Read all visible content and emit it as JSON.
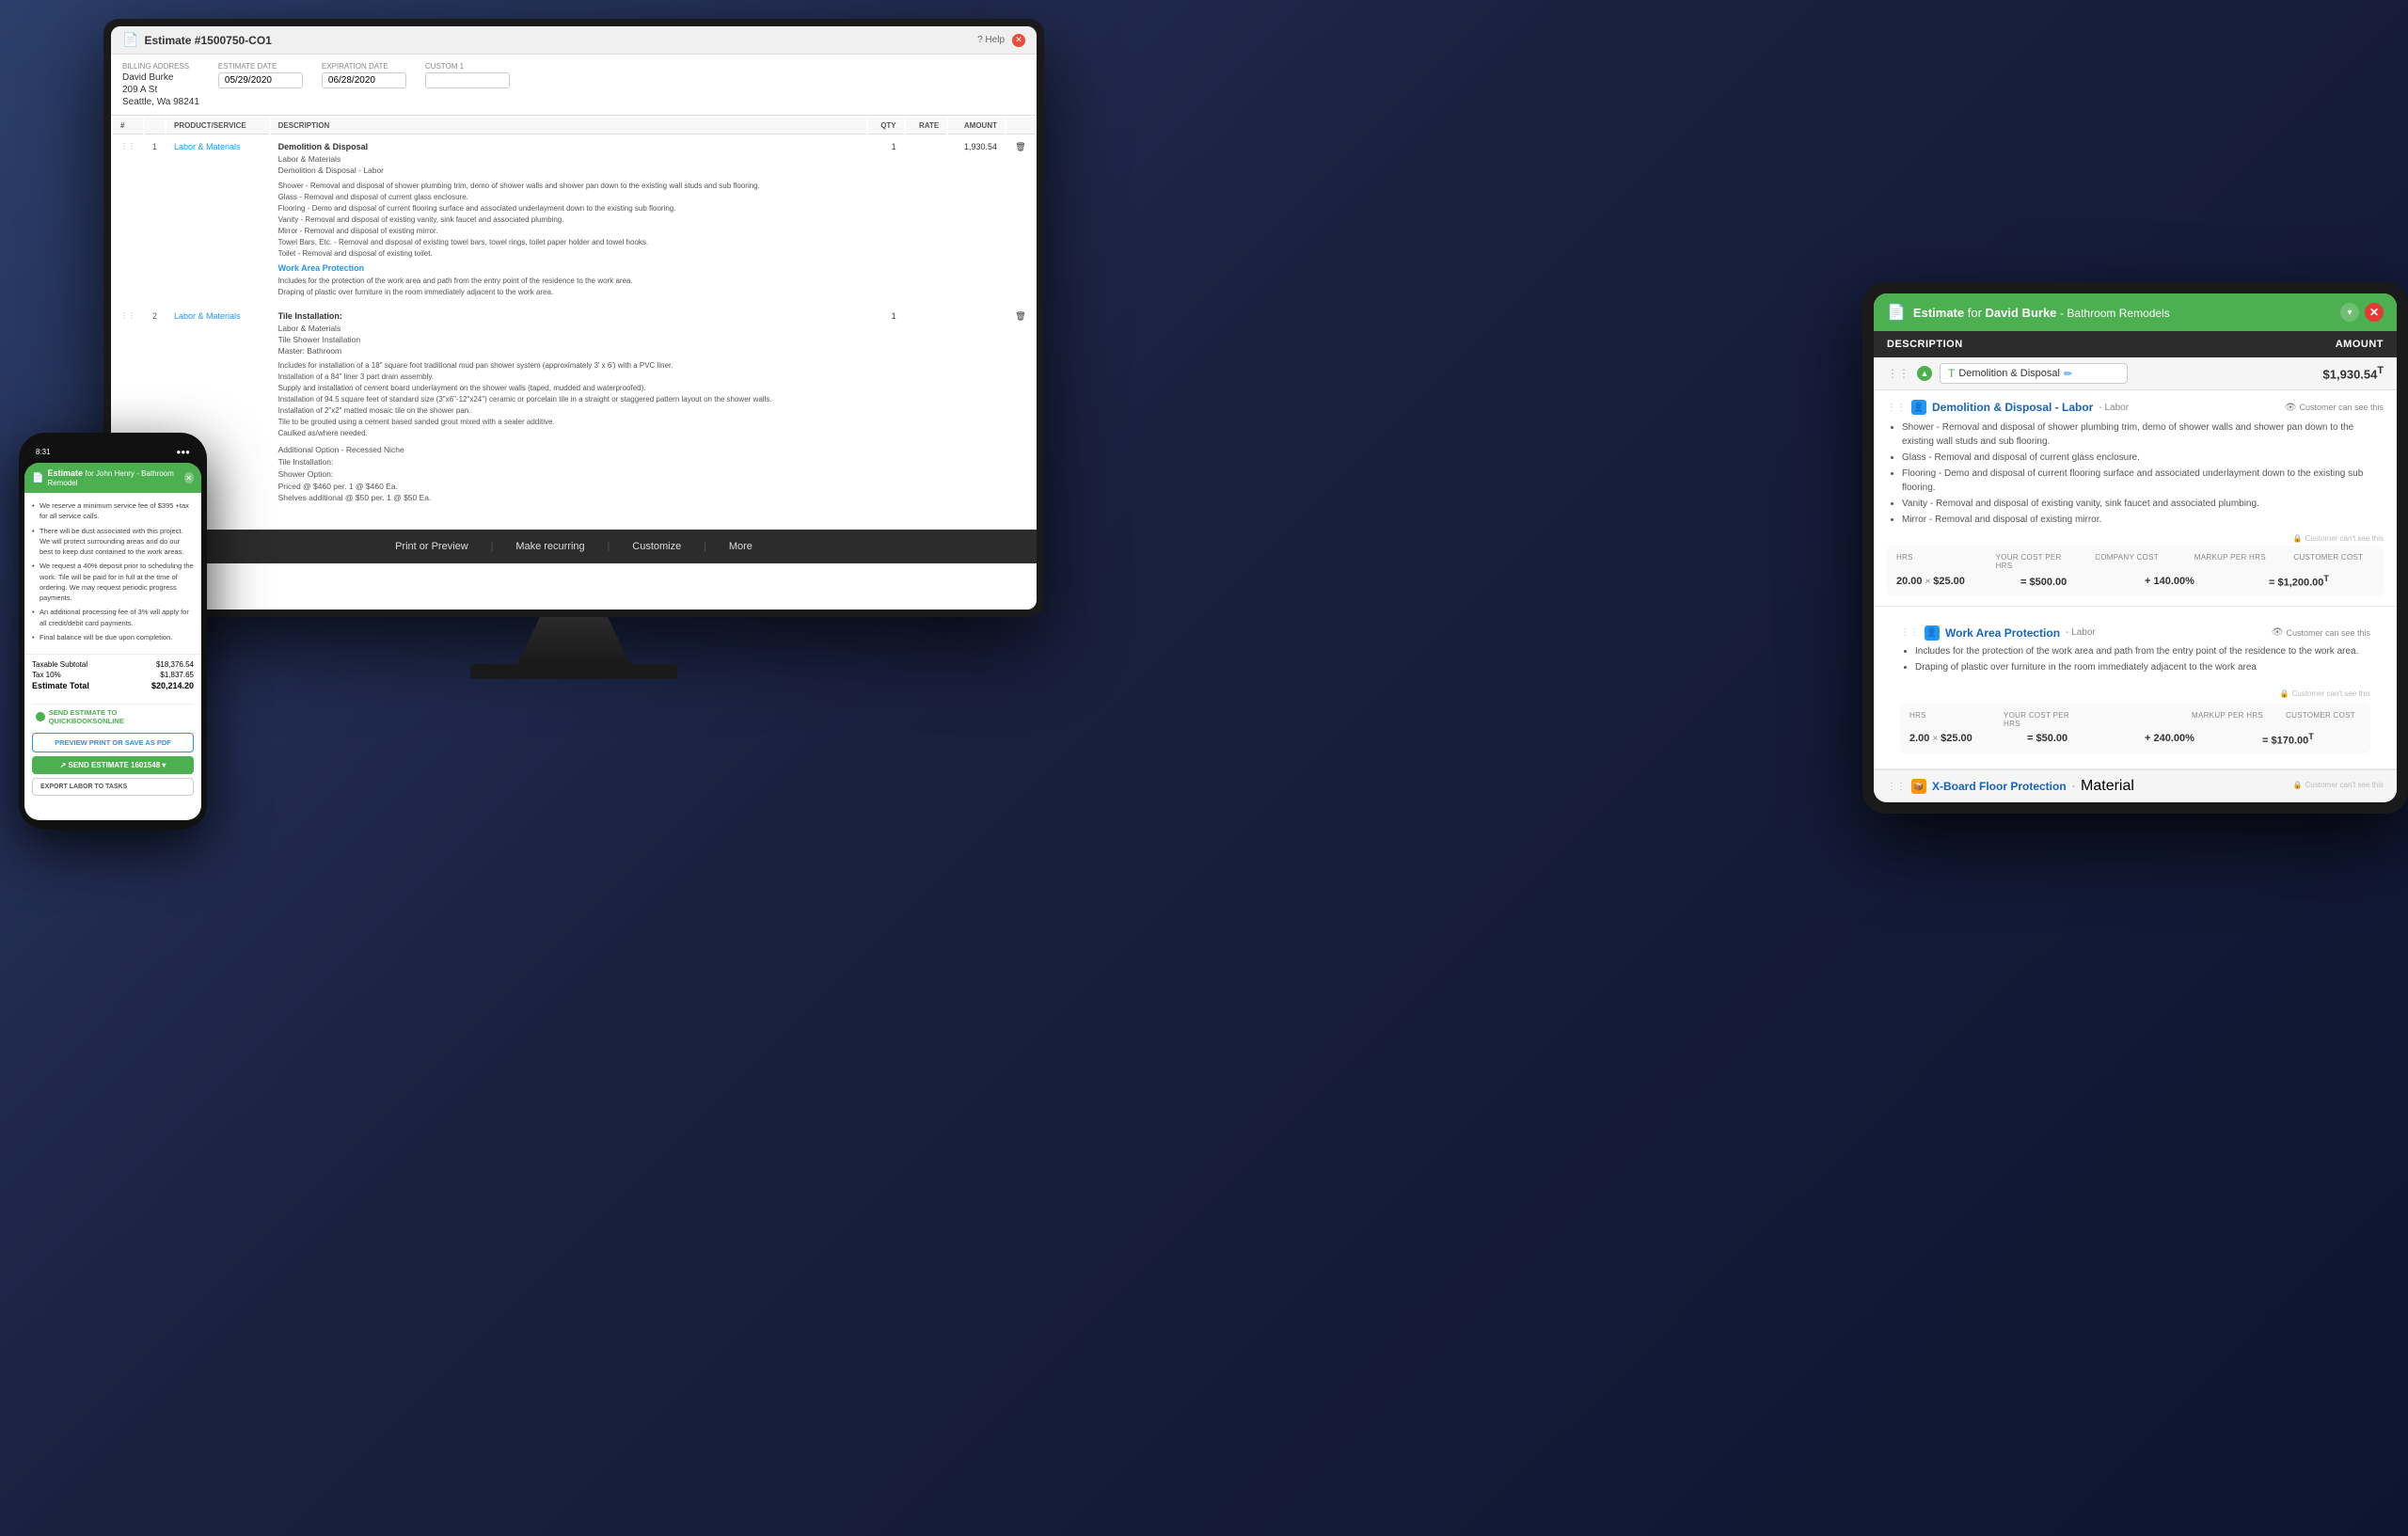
{
  "background": {
    "color": "#1a2040"
  },
  "monitor": {
    "title": "Estimate #1500750-CO1",
    "billing_label": "Billing address",
    "billing_name": "David Burke",
    "billing_address": "209 A St",
    "billing_city": "Seattle, Wa 98241",
    "estimate_date_label": "Estimate date",
    "estimate_date": "05/29/2020",
    "expiration_date_label": "Expiration date",
    "expiration_date": "06/28/2020",
    "custom1_label": "Custom 1",
    "table_headers": {
      "num": "#",
      "product": "PRODUCT/SERVICE",
      "description": "DESCRIPTION",
      "qty": "QTY",
      "rate": "RATE",
      "amount": "AMOUNT"
    },
    "rows": [
      {
        "num": "1",
        "product": "Labor & Materials",
        "description_title": "Demolition & Disposal",
        "description_sub": "Labor & Materials\nDemolition & Disposal - Labor",
        "description_body": "Shower - Removal and disposal of shower plumbing trim, demo of shower walls and shower pan down to the existing wall studs and sub flooring.\nGlass - Removal and disposal of current glass enclosure.\nFlooring - Demo and disposal of current flooring surface and associated underlayment down to the existing sub flooring.\nVanity - Removal and disposal of existing vanity, sink faucet and associated plumbing.\nMirror - Removal and disposal of existing mirror.\nTowel Bars, Etc. - Removal and disposal of existing towel bars, towel rings, toilet paper holder and towel hooks.\nToilet - Removal and disposal of existing toilet.",
        "description_section": "Work Area Protection",
        "description_section_body": "Includes for the protection of the work area and path from the entry point of the residence to the work area.\nDraping of plastic over furniture in the room immediately adjacent to the work area.",
        "qty": "1",
        "rate": "",
        "amount": "1,930.54"
      },
      {
        "num": "2",
        "product": "Labor & Materials",
        "description_title": "Tile Installation:",
        "description_sub": "Labor & Materials\nTile Shower Installation\nMaster: Bathroom",
        "description_body": "Includes for installation of a 18\" square foot traditional mud pan shower system (approximately 3' x 6') with a PVC liner.\nInstallation of a 84\" liner 3 part drain assembly.\nSupply and installation of cement board underlayment on the shower walls (taped, mudded and waterproofed).\nInstallation of 94.5 square feet of standard size (3\"x6\"-12\"x24\") ceramic or porcelain tile in a straight or staggered pattern layout on the shower walls.\nInstallation of 2\"x2\" matted mosaic tile on the shower pan.\nTile to be grouted using a cement based sanded grout mixed with a sealer additive.\nCaulked as/where needed.",
        "qty": "1",
        "rate": "",
        "amount": ""
      }
    ],
    "toolbar": {
      "print_label": "Print or Preview",
      "recurring_label": "Make recurring",
      "customize_label": "Customize",
      "more_label": "More"
    }
  },
  "phone": {
    "time": "8:31",
    "title": "Estimate",
    "subtitle": "for John Henry - Bathroom Remodel",
    "bullets": [
      "We reserve a minimum service fee of $395 +tax for all service calls.",
      "There will be dust associated with this project. We will protect surrounding areas and do our best to keep dust contained to the work areas.",
      "We request a 40% deposit prior to scheduling the work. Tile will be paid for in full at the time of ordering. We may request periodic progress payments.",
      "An additional processing fee of 3% will apply for all credit/debit card payments.",
      "Final balance will be due upon completion."
    ],
    "taxable_subtotal_label": "Taxable Subtotal",
    "taxable_subtotal": "$18,376.54",
    "tax_label": "Tax 10%",
    "tax_value": "$1,837.65",
    "estimate_total_label": "Estimate Total",
    "estimate_total": "$20,214.20",
    "send_qbo_label": "SEND ESTIMATE TO QUICKBOOKSONLINE",
    "preview_label": "PREVIEW PRINT OR SAVE AS PDF",
    "send_estimate_label": "SEND ESTIMATE 1601548",
    "export_labor_label": "EXPORT LABOR TO TASKS"
  },
  "tablet": {
    "title": "Estimate",
    "for_label": "for",
    "client": "David Burke",
    "subtitle": "Bathroom Remodels",
    "col_description": "DESCRIPTION",
    "col_amount": "AMOUNT",
    "section": {
      "title": "Demolition & Disposal",
      "amount": "$1,930.54",
      "amount_sup": "T"
    },
    "items": [
      {
        "name": "Demolition & Disposal - Labor",
        "type": "Labor",
        "customer_see": "Customer can see this",
        "description": [
          "Shower - Removal and disposal of shower plumbing trim, demo of shower walls and shower pan down to the existing wall studs and sub flooring.",
          "Glass - Removal and disposal of current glass enclosure.",
          "Flooring - Demo and disposal of current flooring surface and associated underlayment down to the existing sub flooring.",
          "Vanity - Removal and disposal of existing vanity, sink faucet and associated plumbing.",
          "Mirror - Removal and disposal of existing mirror."
        ],
        "hrs_label": "HRS",
        "your_cost_label": "Your Cost Per HRS",
        "company_cost_label": "Company Cost",
        "markup_label": "Markup Per HRS",
        "customer_cost_label": "Customer Cost",
        "hrs": "20.00",
        "cost_per_hrs": "$25.00",
        "company_cost": "= $500.00",
        "markup": "+ 140.00%",
        "customer_cost": "= $1,200.00",
        "customer_cost_sup": "T",
        "customer_cant_see": "Customer can't see this"
      },
      {
        "name": "Work Area Protection",
        "type": "Labor",
        "customer_see": "Customer can see this",
        "description": [
          "Includes for the protection of the work area and path from the entry point of the residence to the work area.",
          "Draping of plastic over furniture in the room immediately adjacent to the work area"
        ],
        "hrs": "2.00",
        "cost_per_hrs": "$25.00",
        "company_cost": "= $50.00",
        "markup": "+ 240.00%",
        "customer_cost": "= $170.00",
        "customer_cost_sup": "T",
        "customer_cant_see": "Customer can't see this"
      }
    ],
    "xboard": {
      "name": "X-Board Floor Protection",
      "type": "Material",
      "customer_cant_see": "Customer can't see this"
    }
  }
}
